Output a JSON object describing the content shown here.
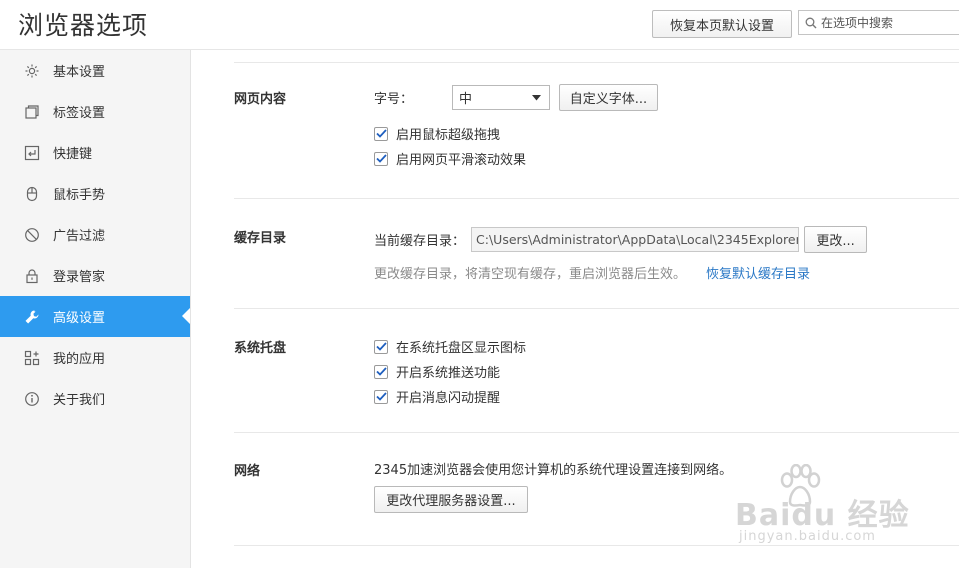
{
  "header": {
    "title": "浏览器选项",
    "restore_button": "恢复本页默认设置",
    "search_placeholder": "在选项中搜索"
  },
  "sidebar": {
    "items": [
      {
        "label": "基本设置",
        "icon": "gear-icon"
      },
      {
        "label": "标签设置",
        "icon": "tabs-icon"
      },
      {
        "label": "快捷键",
        "icon": "shortcut-icon"
      },
      {
        "label": "鼠标手势",
        "icon": "mouse-icon"
      },
      {
        "label": "广告过滤",
        "icon": "block-icon"
      },
      {
        "label": "登录管家",
        "icon": "lock-icon"
      },
      {
        "label": "高级设置",
        "icon": "wrench-icon",
        "active": true
      },
      {
        "label": "我的应用",
        "icon": "apps-icon"
      },
      {
        "label": "关于我们",
        "icon": "info-icon"
      }
    ]
  },
  "sections": {
    "web_content": {
      "title": "网页内容",
      "font_size_label": "字号：",
      "font_size_value": "中",
      "custom_font_button": "自定义字体...",
      "options": [
        {
          "label": "启用鼠标超级拖拽",
          "checked": true
        },
        {
          "label": "启用网页平滑滚动效果",
          "checked": true
        }
      ]
    },
    "cache": {
      "title": "缓存目录",
      "current_label": "当前缓存目录：",
      "path": "C:\\Users\\Administrator\\AppData\\Local\\2345Explorer\\",
      "change_button": "更改...",
      "hint": "更改缓存目录，将清空现有缓存，重启浏览器后生效。",
      "restore_link": "恢复默认缓存目录"
    },
    "tray": {
      "title": "系统托盘",
      "options": [
        {
          "label": "在系统托盘区显示图标",
          "checked": true
        },
        {
          "label": "开启系统推送功能",
          "checked": true
        },
        {
          "label": "开启消息闪动提醒",
          "checked": true
        }
      ]
    },
    "network": {
      "title": "网络",
      "description": "2345加速浏览器会使用您计算机的系统代理设置连接到网络。",
      "proxy_button": "更改代理服务器设置..."
    }
  },
  "watermark": {
    "brand": "Baidu 经验",
    "url": "jingyan.baidu.com"
  },
  "colors": {
    "accent": "#2e9bef",
    "link": "#2a78c6",
    "sidebar_bg": "#f5f5f5"
  }
}
